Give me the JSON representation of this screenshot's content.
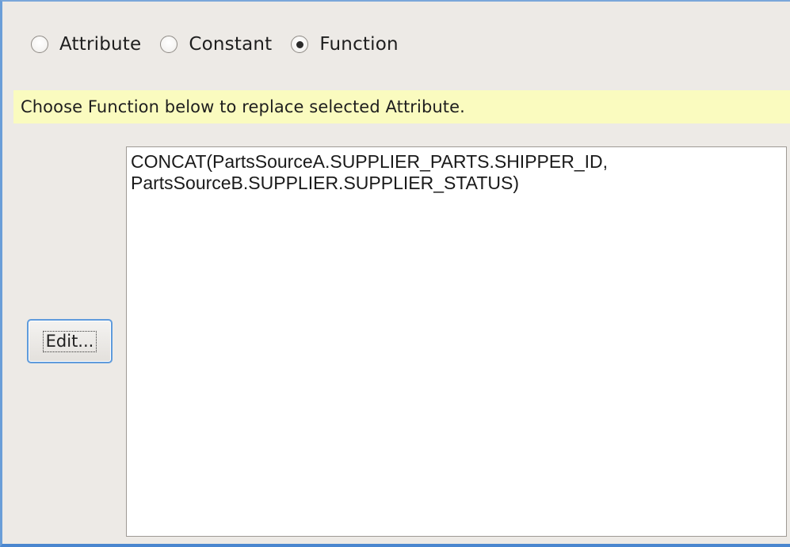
{
  "mapping_type": {
    "options": [
      {
        "label": "Attribute",
        "selected": false
      },
      {
        "label": "Constant",
        "selected": false
      },
      {
        "label": "Function",
        "selected": true
      }
    ]
  },
  "hint": {
    "text": "Choose Function below to replace selected Attribute.",
    "background": "#fafbbf"
  },
  "edit_button": {
    "label": "Edit..."
  },
  "function_expression": {
    "value": "CONCAT(PartsSourceA.SUPPLIER_PARTS.SHIPPER_ID,\nPartsSourceB.SUPPLIER.SUPPLIER_STATUS)"
  },
  "colors": {
    "panel_background": "#edeae6",
    "focus_accent": "#5f9bdc"
  }
}
